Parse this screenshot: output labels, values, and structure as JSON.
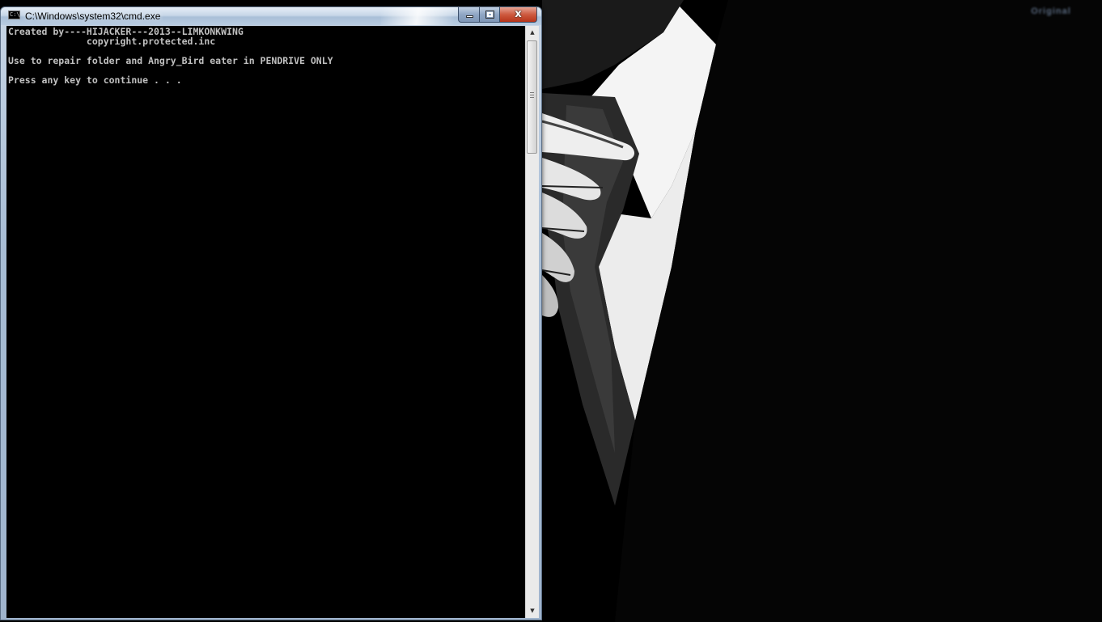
{
  "window": {
    "title": "C:\\Windows\\system32\\cmd.exe",
    "icon": "console-app-icon",
    "icon_text": "C:\\",
    "controls": {
      "minimize_icon": "minimize-icon",
      "maximize_icon": "restore-icon",
      "close_icon": "close-icon",
      "close_glyph": "x"
    }
  },
  "console": {
    "lines": [
      "Created by----HIJACKER---2013--LIMKONKWING",
      "              copyright.protected.inc",
      "",
      "Use to repair folder and Angry_Bird eater in PENDRIVE ONLY",
      "",
      "Press any key to continue . . ."
    ],
    "text_color": "#c0c0c0",
    "background_color": "#000000"
  },
  "scrollbar": {
    "up_glyph": "▲",
    "down_glyph": "▼"
  },
  "desktop": {
    "wallpaper": "suit-and-tie-wallpaper",
    "brand_mark": "Original"
  },
  "colors": {
    "titlebar": "#b8cce1",
    "close_button": "#cd5a3f",
    "desktop_background": "#000000"
  }
}
